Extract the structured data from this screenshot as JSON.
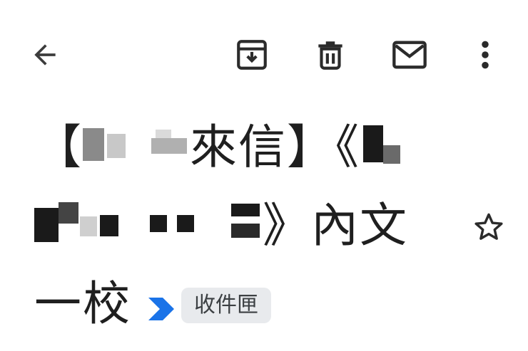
{
  "toolbar": {
    "back_icon": "arrow-back-icon",
    "archive_icon": "archive-icon",
    "delete_icon": "trash-icon",
    "unread_icon": "mail-icon",
    "more_icon": "more-vertical-icon"
  },
  "email": {
    "subject_bracket_open": "【",
    "subject_part1_suffix": "來信】《",
    "subject_part2_suffix": "》內文",
    "subject_part3": "一校",
    "starred": false,
    "important": true,
    "label": "收件匣"
  },
  "colors": {
    "importance_marker": "#1a73e8",
    "chip_background": "#e8eaed",
    "icon": "#3c3c3c"
  }
}
